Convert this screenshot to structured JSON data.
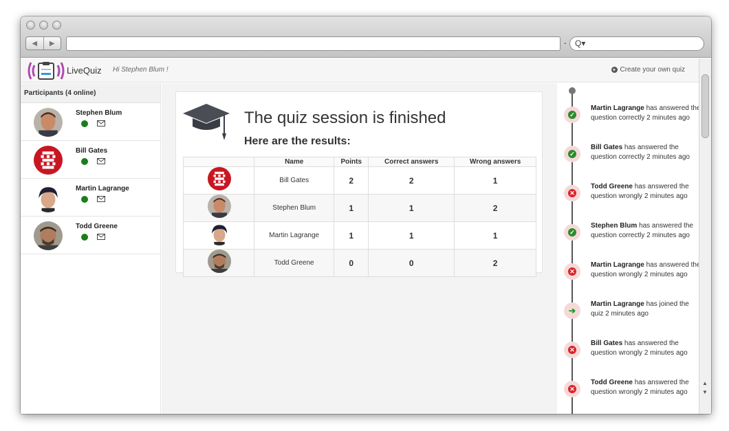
{
  "browser": {
    "back_icon": "◀",
    "forward_icon": "▶",
    "url": "",
    "dash": "-",
    "search_icon": "Q▾"
  },
  "header": {
    "brand": "LiveQuiz",
    "greeting": "Hi Stephen Blum !",
    "create_link": "Create your own quiz"
  },
  "sidebar": {
    "title": "Participants (4 online)",
    "participants": [
      {
        "name": "Stephen Blum"
      },
      {
        "name": "Bill Gates"
      },
      {
        "name": "Martin Lagrange"
      },
      {
        "name": "Todd Greene"
      }
    ],
    "online_color": "#1a7f1a"
  },
  "main": {
    "title": "The quiz session is finished",
    "subtitle": "Here are the results:",
    "columns": [
      "",
      "Name",
      "Points",
      "Correct answers",
      "Wrong answers"
    ],
    "rows": [
      {
        "name": "Bill Gates",
        "points": "2",
        "correct": "2",
        "wrong": "1"
      },
      {
        "name": "Stephen Blum",
        "points": "1",
        "correct": "1",
        "wrong": "2"
      },
      {
        "name": "Martin Lagrange",
        "points": "1",
        "correct": "1",
        "wrong": "1"
      },
      {
        "name": "Todd Greene",
        "points": "0",
        "correct": "0",
        "wrong": "2"
      }
    ]
  },
  "feed": {
    "events": [
      {
        "icon": "check-icon",
        "name": "Martin Lagrange",
        "text": " has answered the question correctly 2 minutes ago"
      },
      {
        "icon": "check-icon",
        "name": "Bill Gates",
        "text": " has answered the question correctly 2 minutes ago"
      },
      {
        "icon": "cross-icon",
        "name": "Todd Greene",
        "text": " has answered the question wrongly 2 minutes ago"
      },
      {
        "icon": "check-icon",
        "name": "Stephen Blum",
        "text": " has answered the question correctly 2 minutes ago"
      },
      {
        "icon": "cross-icon",
        "name": "Martin Lagrange",
        "text": " has answered the question wrongly 2 minutes ago"
      },
      {
        "icon": "join-icon",
        "name": "Martin Lagrange",
        "text": " has joined the quiz 2 minutes ago"
      },
      {
        "icon": "cross-icon",
        "name": "Bill Gates",
        "text": " has answered the question wrongly 2 minutes ago"
      },
      {
        "icon": "cross-icon",
        "name": "Todd Greene",
        "text": " has answered the question wrongly 2 minutes ago"
      }
    ],
    "colors": {
      "correct": "#2c8b2c",
      "wrong": "#d9242a",
      "joined": "#1c9a1c"
    }
  }
}
